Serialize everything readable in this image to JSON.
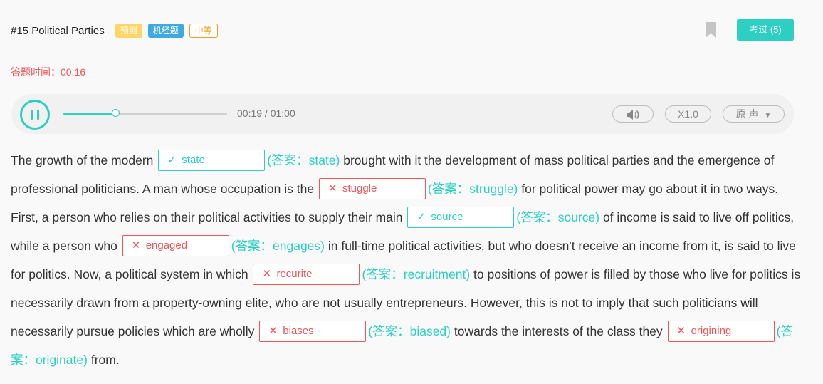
{
  "header": {
    "title": "#15 Political Parties",
    "tags": [
      "预测",
      "机经题",
      "中等"
    ],
    "exam_button": "考过 (5)"
  },
  "timer": "答题时间：00:16",
  "player": {
    "time": "00:19 / 01:00",
    "progress": 0.317,
    "speed": "X1.0",
    "voice": "原 声"
  },
  "passage": {
    "segments": [
      {
        "text": "The growth of the modern"
      },
      {
        "blank": {
          "status": "correct",
          "input": "state",
          "answer": "(答案：state)"
        }
      },
      {
        "text": "brought with it the development of mass political parties and the emergence of professional politicians. A man whose occupation is the"
      },
      {
        "blank": {
          "status": "wrong",
          "input": "stuggle",
          "answer": "(答案：struggle)"
        }
      },
      {
        "text": "for political power may go about it in two ways. First, a person who relies on their political activities to supply their main"
      },
      {
        "blank": {
          "status": "correct",
          "input": "source",
          "answer": "(答案：source)"
        }
      },
      {
        "text": "of income is said to live off politics, while a person who"
      },
      {
        "blank": {
          "status": "wrong",
          "input": "engaged",
          "answer": "(答案：engages)"
        }
      },
      {
        "text": "in full-time political activities, but who doesn't receive an income from it, is said to live for politics. Now, a political system in which"
      },
      {
        "blank": {
          "status": "wrong",
          "input": "recurite",
          "answer": "(答案：recruitment)"
        }
      },
      {
        "text": "to positions of power is filled by those who live for politics is necessarily drawn from a property-owning elite, who are not usually entrepreneurs. However, this is not to imply that such politicians will necessarily pursue policies which are wholly"
      },
      {
        "blank": {
          "status": "wrong",
          "input": "biases",
          "answer": "(答案：biased)"
        }
      },
      {
        "text": "towards the interests of the class they"
      },
      {
        "blank": {
          "status": "wrong",
          "input": "origining",
          "answer": "(答案：originate)"
        }
      },
      {
        "text": "from."
      }
    ]
  },
  "icons": {
    "correct": "check-icon",
    "wrong": "cross-icon",
    "bookmark": "bookmark-icon",
    "volume": "volume-icon",
    "pause": "pause-icon"
  },
  "colors": {
    "accent": "#2ccfc2",
    "error": "#f0555a"
  }
}
